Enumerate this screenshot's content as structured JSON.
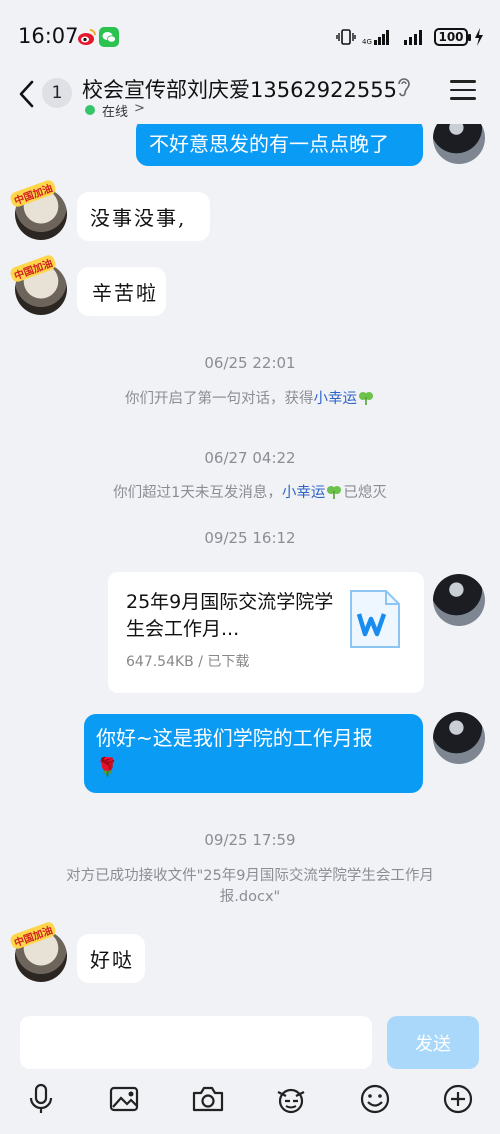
{
  "status_bar": {
    "time": "16:07",
    "battery": "100",
    "icons": [
      "weibo-icon",
      "wechat-icon",
      "vibrate-icon",
      "signal-icon",
      "signal-icon",
      "battery-icon",
      "charging-icon"
    ]
  },
  "header": {
    "unread_count": "1",
    "title": "校会宣传部刘庆爱13562922555",
    "status": "在线",
    "status_chevron": ">"
  },
  "messages": {
    "m1": "不好意思发的有一点点晚了",
    "m2": "没事没事,",
    "m3": "辛苦啦",
    "ts1": "06/25 22:01",
    "sys1_prefix": "你们开启了第一句对话，获得",
    "sys1_link": "小幸运",
    "ts2": "06/27 04:22",
    "sys2_prefix": "你们超过1天未互发消息，",
    "sys2_link": "小幸运",
    "sys2_suffix": "已熄灭",
    "ts3": "09/25 16:12",
    "file_name": "25年9月国际交流学院学生会工作月...",
    "file_meta": "647.54KB / 已下载",
    "m4_line1": "你好~这是我们学院的工作月报",
    "m4_emoji": "🌹",
    "ts4": "09/25 17:59",
    "sys3": "对方已成功接收文件\"25年9月国际交流学院学生会工作月报.docx\"",
    "m5": "好哒",
    "avatar_badge": "中国加油"
  },
  "input": {
    "placeholder": "",
    "send_label": "发送"
  },
  "colors": {
    "accent": "#0a9bf5",
    "background": "#f1f2f6",
    "link": "#2f64c8",
    "online": "#35c46a"
  }
}
